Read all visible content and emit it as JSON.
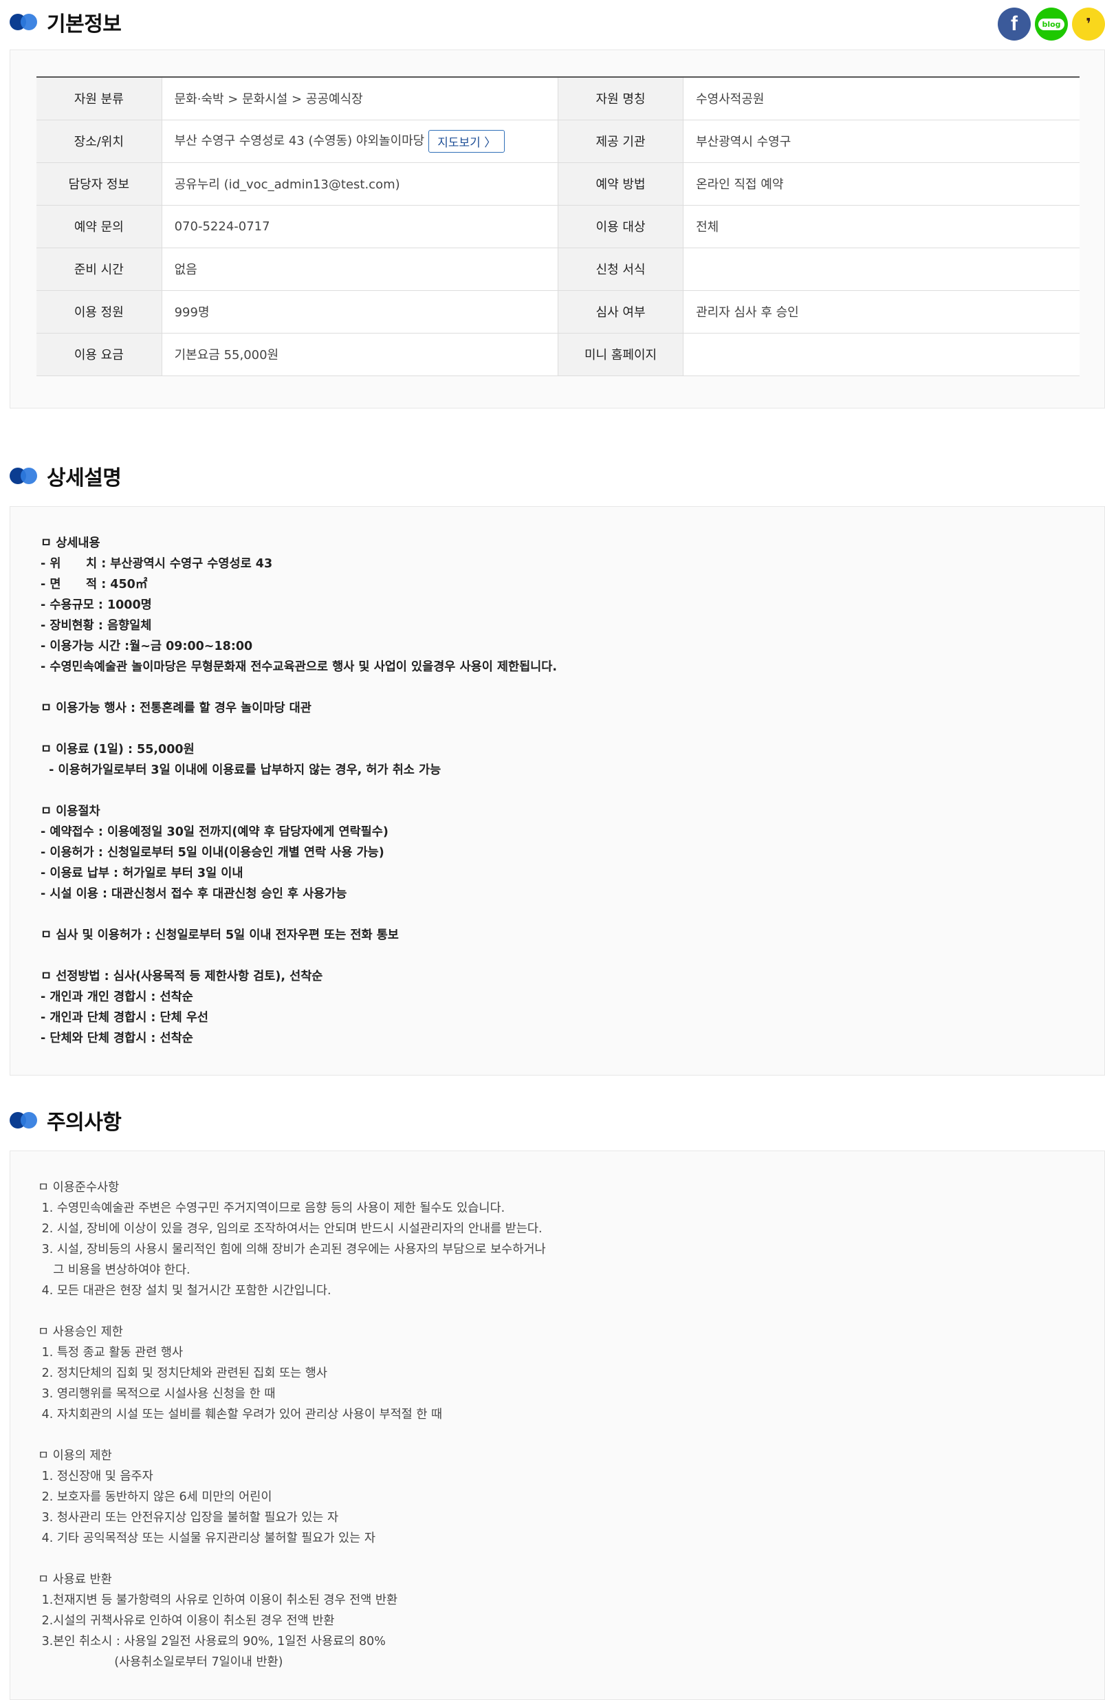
{
  "sections": {
    "basic": "기본정보",
    "detail": "상세설명",
    "notice": "주의사항"
  },
  "share": {
    "facebook": "f",
    "blog": "blog",
    "kakao": "❜"
  },
  "info": {
    "rows": [
      {
        "h1": "자원 분류",
        "v1": "문화·숙박 > 문화시설 > 공공예식장",
        "h2": "자원 명칭",
        "v2": "수영사적공원"
      },
      {
        "h1": "장소/위치",
        "v1": "부산 수영구 수영성로 43 (수영동) 야외놀이마당",
        "h2": "제공 기관",
        "v2": "부산광역시 수영구"
      },
      {
        "h1": "담당자 정보",
        "v1": "공유누리  (id_voc_admin13@test.com)",
        "h2": "예약 방법",
        "v2": "온라인 직접 예약"
      },
      {
        "h1": "예약 문의",
        "v1": "070-5224-0717",
        "h2": "이용 대상",
        "v2": "전체"
      },
      {
        "h1": "준비 시간",
        "v1": "없음",
        "h2": "신청 서식",
        "v2": ""
      },
      {
        "h1": "이용 정원",
        "v1": "999명",
        "h2": "심사 여부",
        "v2": "관리자 심사 후 승인"
      },
      {
        "h1": "이용 요금",
        "v1": "기본요금 55,000원",
        "h2": "미니 홈페이지",
        "v2": ""
      }
    ],
    "map_button": "지도보기 〉"
  },
  "detail_lines": [
    "ㅁ 상세내용",
    "- 위      치 : 부산광역시 수영구 수영성로 43",
    "- 면      적 : 450㎡",
    "- 수용규모 : 1000명",
    "- 장비현황 : 음향일체",
    "- 이용가능 시간 :월~금 09:00~18:00",
    "- 수영민속예술관 놀이마당은 무형문화재 전수교육관으로 행사 및 사업이 있을경우 사용이 제한됩니다.",
    "",
    "ㅁ 이용가능 행사 : 전통혼례를 할 경우 놀이마당 대관",
    "",
    "ㅁ 이용료 (1일) : 55,000원",
    "  - 이용허가일로부터 3일 이내에 이용료를 납부하지 않는 경우, 허가 취소 가능",
    "",
    "ㅁ 이용절차",
    "- 예약접수 : 이용예정일 30일 전까지(예약 후 담당자에게 연락필수)",
    "- 이용허가 : 신청일로부터 5일 이내(이용승인 개별 연락 사용 가능)",
    "- 이용료 납부 : 허가일로 부터 3일 이내",
    "- 시설 이용 : 대관신청서 접수 후 대관신청 승인 후 사용가능",
    "",
    "ㅁ 심사 및 이용허가 : 신청일로부터 5일 이내 전자우편 또는 전화 통보",
    "",
    "ㅁ 선정방법 : 심사(사용목적 등 제한사항 검토), 선착순",
    "- 개인과 개인 경합시 : 선착순",
    "- 개인과 단체 경합시 : 단체 우선",
    "- 단체와 단체 경합시 : 선착순"
  ],
  "notice_lines": [
    "ㅁ 이용준수사항",
    " 1. 수영민속예술관 주변은 수영구민 주거지역이므로 음향 등의 사용이 제한 될수도 있습니다.",
    " 2. 시설, 장비에 이상이 있을 경우, 임의로 조작하여서는 안되며 반드시 시설관리자의 안내를 받는다.",
    " 3. 시설, 장비등의 사용시 물리적인 힘에 의해 장비가 손괴된 경우에는 사용자의 부담으로 보수하거나",
    "    그 비용을 변상하여야 한다.",
    " 4. 모든 대관은 현장 설치 및 철거시간 포함한 시간입니다.",
    "",
    "ㅁ 사용승인 제한",
    " 1. 특정 종교 활동 관련 행사",
    " 2. 정치단체의 집회 및 정치단체와 관련된 집회 또는 행사",
    " 3. 영리행위를 목적으로 시설사용 신청을 한 때",
    " 4. 자치회관의 시설 또는 설비를 훼손할 우려가 있어 관리상 사용이 부적절 한 때",
    "",
    "ㅁ 이용의 제한",
    " 1. 정신장애 및 음주자",
    " 2. 보호자를 동반하지 않은 6세 미만의 어린이",
    " 3. 청사관리 또는 안전유지상 입장을 불허할 필요가 있는 자",
    " 4. 기타 공익목적상 또는 시설물 유지관리상 불허할 필요가 있는 자",
    "",
    "ㅁ 사용료 반환",
    " 1.천재지변 등 불가항력의 사유로 인하여 이용이 취소된 경우 전액 반환",
    " 2.시설의 귀책사유로 인하여 이용이 취소된 경우 전액 반환",
    " 3.본인 취소시 : 사용일 2일전 사용료의 90%, 1일전 사용료의 80%",
    "                    (사용취소일로부터 7일이내 반환)"
  ]
}
